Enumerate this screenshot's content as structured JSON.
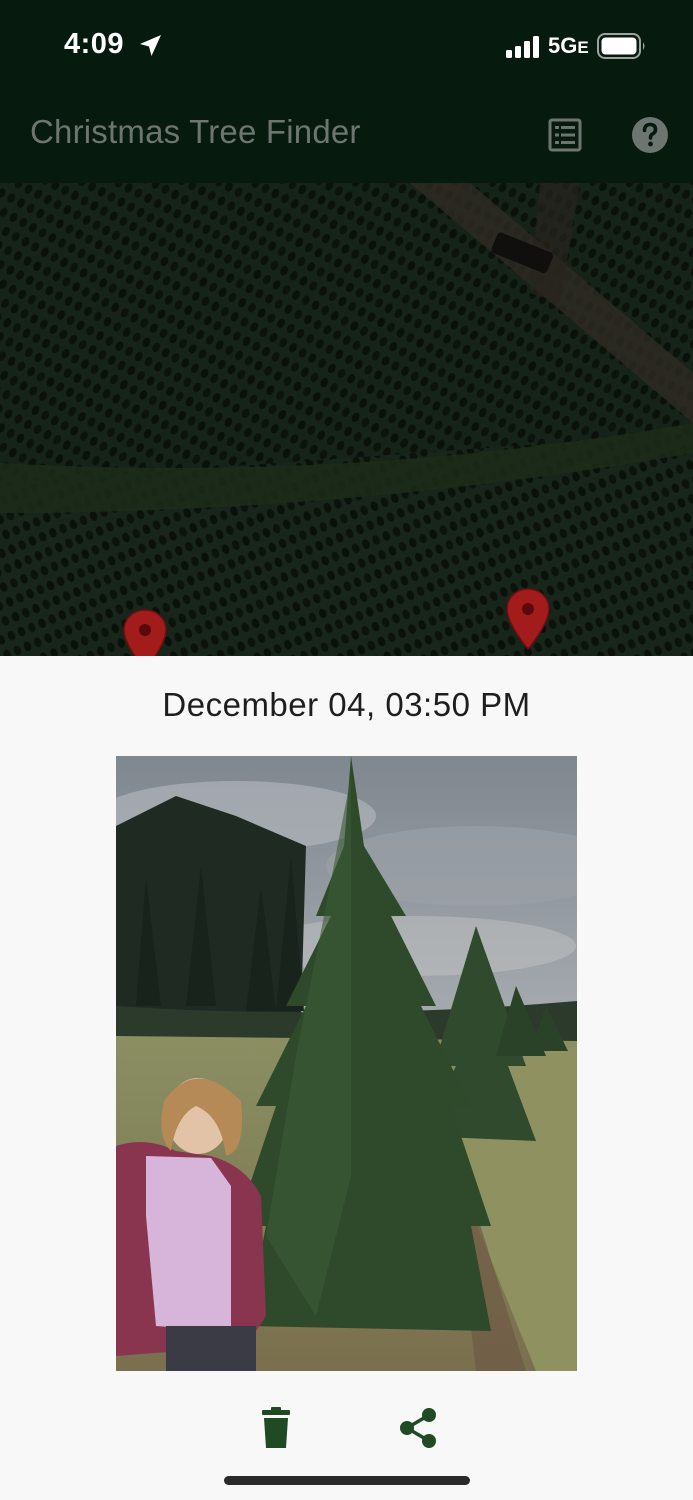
{
  "status_bar": {
    "time": "4:09",
    "network": "5G",
    "network_suffix": "E"
  },
  "app_bar": {
    "title": "Christmas Tree Finder",
    "list_icon": "list-icon",
    "help_icon": "help-icon"
  },
  "map": {
    "pin_icon": "map-pin-icon",
    "pin_color": "#a31c1c"
  },
  "detail": {
    "timestamp": "December 04, 03:50 PM",
    "photo_icon": "tree-photo",
    "delete_icon": "trash-icon",
    "share_icon": "share-icon"
  },
  "colors": {
    "app_bar_bg": "#061a0e",
    "accent": "#1f4a24",
    "title_text": "#6d7570",
    "sheet_bg": "#f8f8f8"
  }
}
